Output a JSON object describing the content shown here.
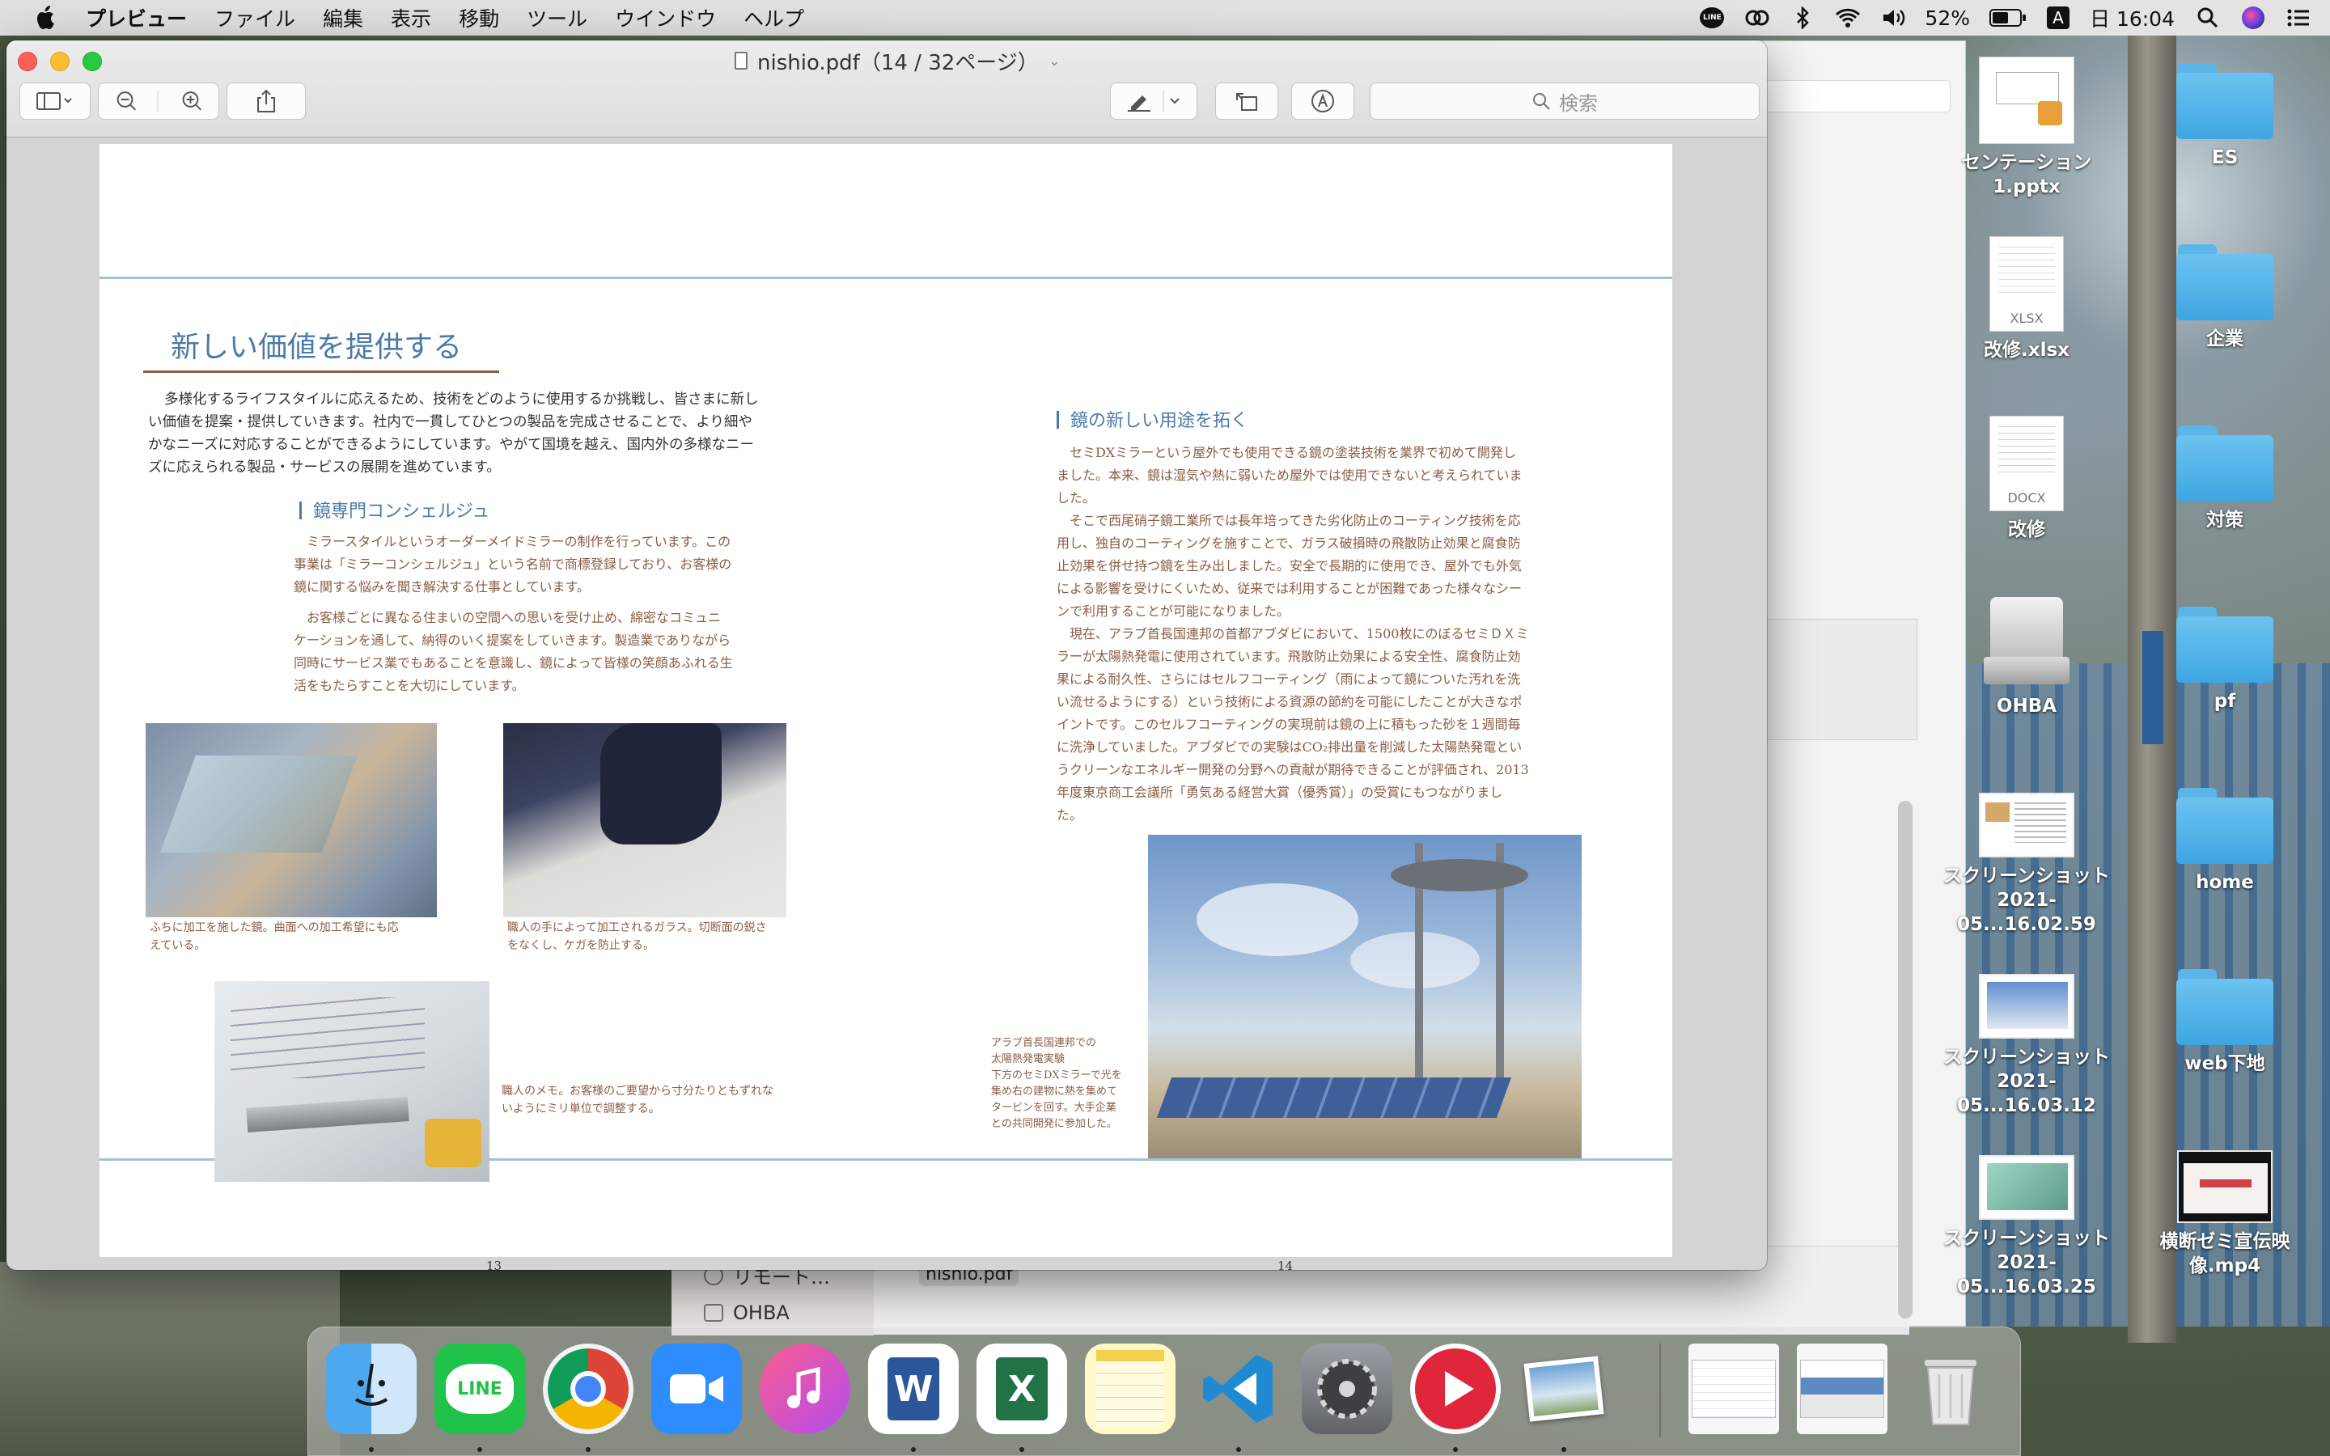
{
  "menubar": {
    "app_name": "プレビュー",
    "items": [
      "ファイル",
      "編集",
      "表示",
      "移動",
      "ツール",
      "ウインドウ",
      "ヘルプ"
    ],
    "battery": "52%",
    "clock": "日 16:04",
    "input_source": "A"
  },
  "window": {
    "title": "nishio.pdf（14 / 32ページ）",
    "search_placeholder": "検索"
  },
  "document": {
    "title": "新しい価値を提供する",
    "intro": [
      "多様化するライフスタイルに応えるため、技術をどのように使用するか挑戦し、皆さまに新し",
      "い価値を提案・提供していきます。社内で一貫してひとつの製品を完成させることで、より細や",
      "かなニーズに対応することができるようにしています。やがて国境を越え、国内外の多様なニー",
      "ズに応えられる製品・サービスの展開を進めています。"
    ],
    "section1_heading": "鏡専門コンシェルジュ",
    "section1_para1": [
      "ミラースタイルというオーダーメイドミラーの制作を行っています。この",
      "事業は「ミラーコンシェルジュ」という名前で商標登録しており、お客様の",
      "鏡に関する悩みを聞き解決する仕事としています。"
    ],
    "section1_para2": [
      "お客様ごとに異なる住まいの空間への思いを受け止め、綿密なコミュニ",
      "ケーションを通して、納得のいく提案をしていきます。製造業でありながら",
      "同時にサービス業でもあることを意識し、鏡によって皆様の笑顔あふれる生",
      "活をもたらすことを大切にしています。"
    ],
    "caption1": [
      "ふちに加工を施した鏡。曲面への加工希望にも応",
      "えている。"
    ],
    "caption2": [
      "職人の手によって加工されるガラス。切断面の鋭さ",
      "をなくし、ケガを防止する。"
    ],
    "caption3": [
      "職人のメモ。お客様のご要望から寸分たりともずれな",
      "いようにミリ単位で調整する。"
    ],
    "section2_heading": "鏡の新しい用途を拓く",
    "section2_para1": [
      "セミDXミラーという屋外でも使用できる鏡の塗装技術を業界で初めて開発し",
      "ました。本来、鏡は湿気や熱に弱いため屋外では使用できないと考えられていま",
      "した。"
    ],
    "section2_para2": [
      "そこで西尾硝子鏡工業所では長年培ってきた劣化防止のコーティング技術を応",
      "用し、独自のコーティングを施すことで、ガラス破損時の飛散防止効果と腐食防",
      "止効果を併せ持つ鏡を生み出しました。安全で長期的に使用でき、屋外でも外気",
      "による影響を受けにくいため、従来では利用することが困難であった様々なシー",
      "ンで利用することが可能になりました。"
    ],
    "section2_para3": [
      "現在、アラブ首長国連邦の首都アブダビにおいて、1500枚にのぼるセミＤＸミ",
      "ラーが太陽熱発電に使用されています。飛散防止効果による安全性、腐食防止効",
      "果による耐久性、さらにはセルフコーティング（雨によって鏡についた汚れを洗",
      "い流せるようにする）という技術による資源の節約を可能にしたことが大きなポ",
      "イントです。このセルフコーティングの実現前は鏡の上に積もった砂を１週間毎",
      "に洗浄していました。アブダビでの実験はCO₂排出量を削減した太陽熱発電とい",
      "うクリーンなエネルギー開発の分野への貢献が期待できることが評価され、2013",
      "年度東京商工会議所「勇気ある経営大賞（優秀賞）」の受賞にもつながりまし",
      "た。"
    ],
    "caption4": [
      "アラブ首長国連邦での",
      "太陽熱発電実験",
      "下方のセミDXミラーで光を",
      "集め右の建物に熱を集めて",
      "タービンを回す。大手企業",
      "との共同開発に参加した。"
    ],
    "page_left": "13",
    "page_right": "14"
  },
  "finder_background": {
    "sidebar_item1": "リモート…",
    "sidebar_item2": "OHBA",
    "file_tag": "nishio.pdf"
  },
  "desktop": {
    "col1": [
      "センテーション\n1.pptx",
      "改修.xlsx",
      "改修",
      "OHBA",
      "スクリーンショット\n2021-05...16.02.59",
      "スクリーンショット\n2021-05...16.03.12",
      "スクリーンショット\n2021-05...16.03.25"
    ],
    "col2": [
      "ES",
      "企業",
      "対策",
      "pf",
      "home",
      "web下地",
      "横断ゼミ宣伝映\n像.mp4"
    ],
    "doc_tags": [
      "XLSX",
      "DOCX"
    ]
  },
  "dock": {
    "apps": [
      "finder-icon",
      "line-icon",
      "chrome-icon",
      "zoom-icon",
      "music-icon",
      "word-icon",
      "excel-icon",
      "notes-icon",
      "vscode-icon",
      "system-preferences-icon",
      "screen-recorder-icon",
      "preview-icon",
      "finder-window-icon",
      "screen-capture-icon",
      "trash-icon"
    ],
    "line_label": "LINE"
  }
}
